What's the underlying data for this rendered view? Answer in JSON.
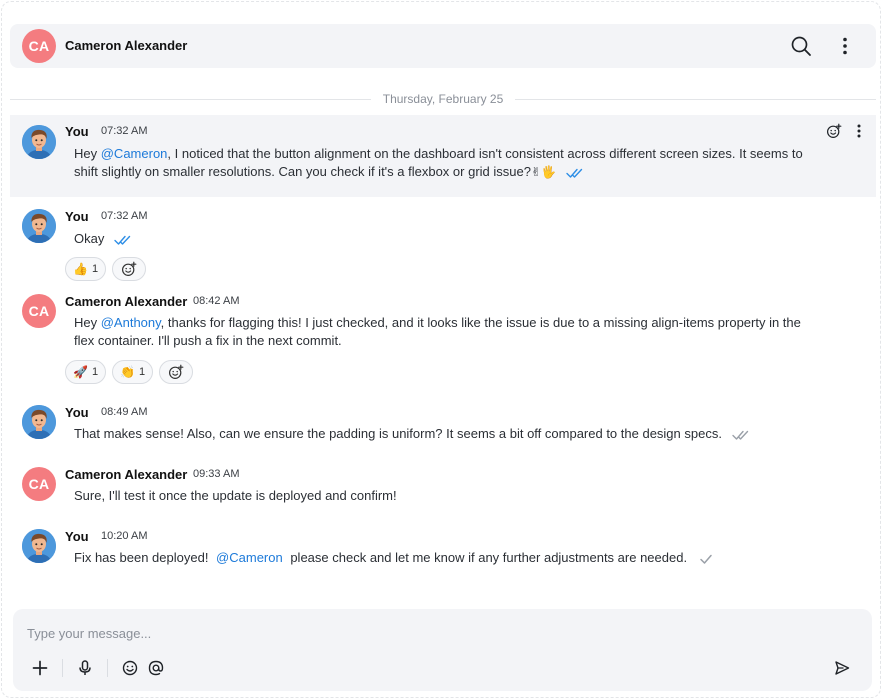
{
  "header": {
    "avatar_initials": "CA",
    "name": "Cameron Alexander",
    "icons": [
      "search-icon",
      "more-vertical-icon"
    ]
  },
  "date_separator": "Thursday, February 25",
  "messages": [
    {
      "sender": "You",
      "time": "07:32 AM",
      "text_parts": [
        "Hey ",
        "@Cameron",
        ", I noticed that the button alignment on the dashboard isn't consistent across different screen sizes. It seems to shift slightly on smaller resolutions. Can you check if it's a flexbox or grid issue?",
        "✌🖐"
      ],
      "status": "read",
      "highlighted": true
    },
    {
      "sender": "You",
      "time": "07:32 AM",
      "text": "Okay",
      "status": "read",
      "reactions": [
        {
          "emoji": "👍",
          "count": "1"
        }
      ]
    },
    {
      "sender": "Cameron Alexander",
      "avatar_initials": "CA",
      "time": "08:42 AM",
      "text_parts": [
        "Hey ",
        "@Anthony",
        ", thanks for flagging this! I just checked, and it looks like the issue is due to a missing align-items property in the flex container. I'll push a fix in the next commit."
      ],
      "reactions": [
        {
          "emoji": "🚀",
          "count": "1"
        },
        {
          "emoji": "👏",
          "count": "1"
        }
      ]
    },
    {
      "sender": "You",
      "time": "08:49 AM",
      "text": "That makes sense! Also, can we ensure the padding is uniform? It seems a bit off compared to the design specs.",
      "status": "delivered"
    },
    {
      "sender": "Cameron Alexander",
      "avatar_initials": "CA",
      "time": "09:33 AM",
      "text": "Sure, I'll test it once the update is deployed and confirm!"
    },
    {
      "sender": "You",
      "time": "10:20 AM",
      "text_parts": [
        "Fix has been deployed! ",
        "@Cameron",
        " please check and let me know if any further adjustments are needed."
      ],
      "status": "sent"
    }
  ],
  "composer": {
    "placeholder": "Type your message...",
    "icons": [
      "plus-icon",
      "microphone-icon",
      "emoji-icon",
      "at-icon",
      "send-icon"
    ]
  },
  "colors": {
    "accent": "#1d7ad9",
    "avatar_ca": "#f47c80",
    "read_tick": "#2d8ee6",
    "grey_tick": "#9aa0a8",
    "panel": "#f3f4f7"
  }
}
